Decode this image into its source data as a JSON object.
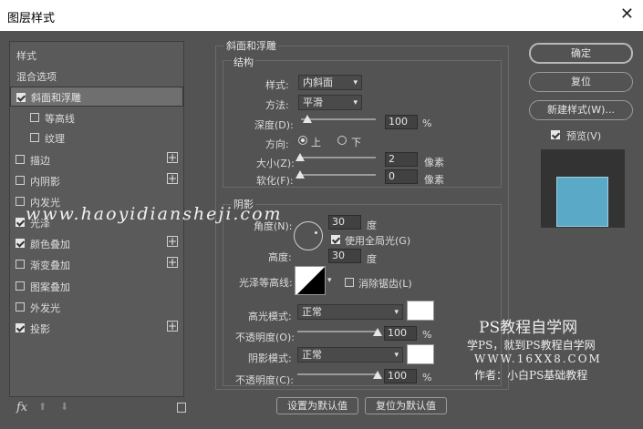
{
  "window": {
    "title": "图层样式",
    "close": "✕"
  },
  "left": {
    "items": [
      {
        "label": "样式"
      },
      {
        "label": "混合选项"
      },
      {
        "label": "斜面和浮雕",
        "checked": true
      },
      {
        "label": "等高线",
        "checked": false
      },
      {
        "label": "纹理",
        "checked": false
      },
      {
        "label": "描边",
        "checked": false,
        "plus": "+"
      },
      {
        "label": "内阴影",
        "checked": false,
        "plus": "+"
      },
      {
        "label": "内发光",
        "checked": false
      },
      {
        "label": "光泽",
        "checked": true
      },
      {
        "label": "颜色叠加",
        "checked": true,
        "plus": "+"
      },
      {
        "label": "渐变叠加",
        "checked": false,
        "plus": "+"
      },
      {
        "label": "图案叠加",
        "checked": false
      },
      {
        "label": "外发光",
        "checked": false
      },
      {
        "label": "投影",
        "checked": true,
        "plus": "+"
      }
    ],
    "bottom": {
      "fx": "fx",
      "up": "⬆",
      "down": "⬇",
      "trash": "🗑"
    }
  },
  "bevel": {
    "section": "斜面和浮雕",
    "structure": "结构",
    "style_label": "样式:",
    "style_value": "内斜面",
    "technique_label": "方法:",
    "technique_value": "平滑",
    "depth_label": "深度(D):",
    "depth_value": "100",
    "depth_unit": "%",
    "direction_label": "方向:",
    "dir_up": "上",
    "dir_down": "下",
    "size_label": "大小(Z):",
    "size_value": "2",
    "size_unit": "像素",
    "soften_label": "软化(F):",
    "soften_value": "0",
    "soften_unit": "像素",
    "shading": "阴影",
    "angle_label": "角度(N):",
    "angle_value": "30",
    "angle_unit": "度",
    "global_light": "使用全局光(G)",
    "altitude_label": "高度:",
    "altitude_value": "30",
    "altitude_unit": "度",
    "gloss_label": "光泽等高线:",
    "antialias": "消除锯齿(L)",
    "hl_mode_label": "高光模式:",
    "hl_mode_value": "正常",
    "hl_opacity_label": "不透明度(O):",
    "hl_opacity_value": "100",
    "hl_opacity_unit": "%",
    "sh_mode_label": "阴影模式:",
    "sh_mode_value": "正常",
    "sh_opacity_label": "不透明度(C):",
    "sh_opacity_value": "100",
    "sh_opacity_unit": "%",
    "set_default": "设置为默认值",
    "reset_default": "复位为默认值"
  },
  "right": {
    "ok": "确定",
    "reset": "复位",
    "new_style": "新建样式(W)...",
    "preview": "预览(V)",
    "preview_color": "#5aa9c6"
  },
  "watermark": {
    "url": "www.haoyidiansheji.com",
    "ps_title": "PS教程自学网",
    "line1": "学PS，就到PS教程自学网",
    "line2": "WWW.16XX8.COM",
    "line3": "作者：小白PS基础教程"
  }
}
